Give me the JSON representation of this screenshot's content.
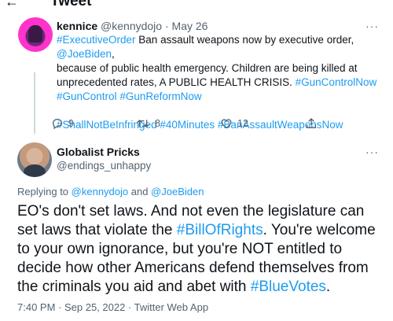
{
  "header": {
    "title": "Tweet",
    "back_icon": "arrow-left-icon"
  },
  "tweet1": {
    "display_name": "kennice",
    "handle": "@kennydojo",
    "separator": "·",
    "date": "May 26",
    "more": "···",
    "body": {
      "line1_tag": "#ExecutiveOrder",
      "line1_text": " Ban assault weapons now by executive order, ",
      "line1_mention": "@JoeBiden",
      "line1_end": ",",
      "line2": "because of public health emergency. Children are being killed at",
      "line3_text": "unprecedented rates, A PUBLIC HEALTH CRISIS. ",
      "line3_tag": "#GunControlNow",
      "line4_tag1": "#GunControl",
      "line4_tag2": "#GunReformNow",
      "line5_tag1": "#ShallNotBeInfringed",
      "line5_tag2": "#40Minutes",
      "line5_tag3": "#BanAssaultWeaponsNow"
    },
    "actions": {
      "replies": "9",
      "retweets": "8",
      "likes": "12"
    }
  },
  "tweet2": {
    "display_name": "Globalist Pricks",
    "handle": "@endings_unhappy",
    "more": "···",
    "replying_prefix": "Replying to ",
    "replying_user1": "@kennydojo",
    "replying_and": " and ",
    "replying_user2": "@JoeBiden",
    "text": {
      "p1": "EO's don't set laws.  And not even the legislature can set laws that violate the ",
      "tag1": "#BillOfRights",
      "p2": ".  You're welcome to your own ignorance, but you're NOT entitled to decide how other Americans defend themselves from the criminals you aid and abet with ",
      "tag2": "#BlueVotes",
      "p3": "."
    },
    "meta": "7:40 PM · Sep 25, 2022 · Twitter Web App"
  },
  "colors": {
    "link": "#1d9bf0",
    "muted": "#536471",
    "text": "#0f1419"
  }
}
